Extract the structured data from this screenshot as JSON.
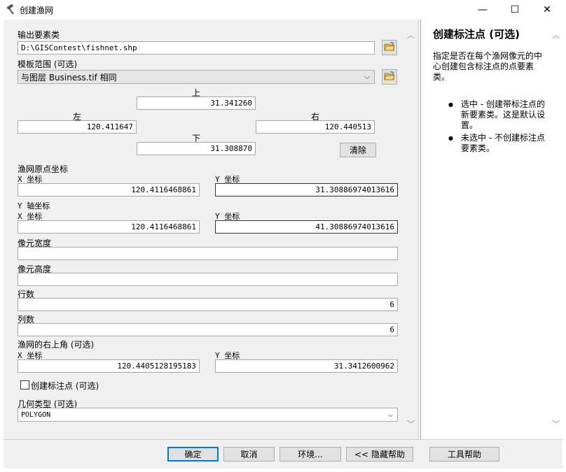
{
  "window": {
    "title": "创建渔网",
    "minimize": "—",
    "maximize": "☐",
    "close": "✕"
  },
  "output": {
    "label": "输出要素类",
    "value": "D:\\GISContest\\fishnet.shp"
  },
  "template": {
    "label": "模板范围 (可选)",
    "value": "与图层 Business.tif 相同"
  },
  "extent": {
    "top_label": "上",
    "top_value": "31.341260",
    "left_label": "左",
    "left_value": "120.411647",
    "right_label": "右",
    "right_value": "120.440513",
    "bottom_label": "下",
    "bottom_value": "31.308870",
    "clear_label": "清除"
  },
  "origin": {
    "label": "渔网原点坐标",
    "x_label": "X 坐标",
    "x_value": "120.4116468861",
    "y_label": "Y 坐标",
    "y_value": "31.30886974013616"
  },
  "yaxis": {
    "label": "Y 轴坐标",
    "x_label": "X 坐标",
    "x_value": "120.4116468861",
    "y_label": "Y 坐标",
    "y_value": "41.30886974013616"
  },
  "cell_width": {
    "label": "像元宽度",
    "value": ""
  },
  "cell_height": {
    "label": "像元高度",
    "value": ""
  },
  "rows": {
    "label": "行数",
    "value": "6"
  },
  "cols": {
    "label": "列数",
    "value": "6"
  },
  "corner": {
    "label": "渔网的右上角 (可选)",
    "x_label": "X 坐标",
    "x_value": "120.4405128195183",
    "y_label": "Y 坐标",
    "y_value": "31.3412600962"
  },
  "label_points": {
    "label": "创建标注点 (可选)",
    "checked": false
  },
  "geometry": {
    "label": "几何类型 (可选)",
    "value": "POLYGON"
  },
  "buttons": {
    "ok": "确定",
    "cancel": "取消",
    "env": "环境...",
    "hide_help": "<< 隐藏帮助",
    "tool_help": "工具帮助"
  },
  "help": {
    "title": "创建标注点 (可选)",
    "text": "指定是否在每个渔网像元的中心创建包含标注点的点要素类。",
    "bullets": [
      "选中 - 创建带标注点的新要素类。这是默认设置。",
      "未选中 - 不创建标注点要素类。"
    ]
  },
  "icons": {
    "title": "hammer-icon",
    "folder": "folder-open-icon",
    "scroll_up": "chevron-up-icon",
    "scroll_down": "chevron-down-icon"
  }
}
